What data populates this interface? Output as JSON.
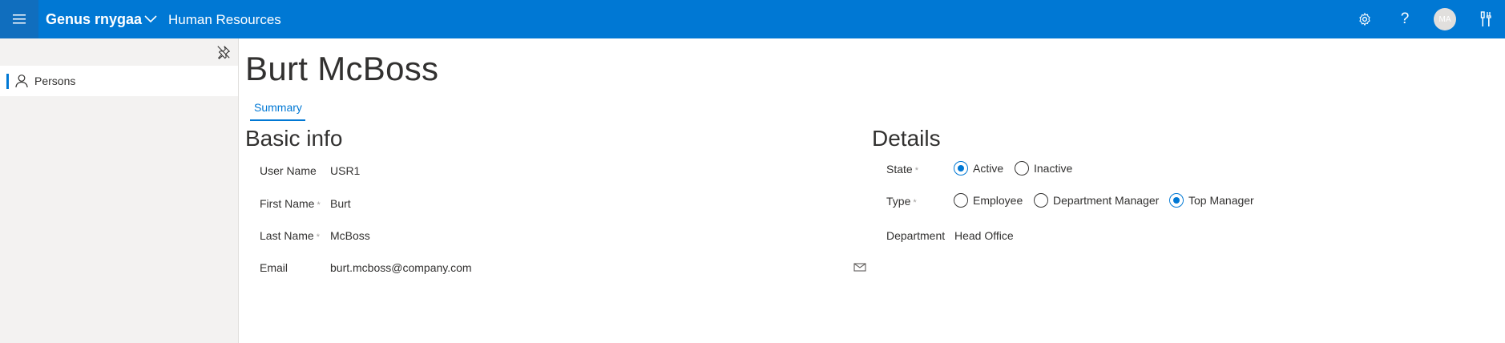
{
  "topbar": {
    "app_name": "Genus rnygaa",
    "module_name": "Human Resources",
    "avatar_initials": "MA",
    "help_glyph": "?",
    "accent_color": "#0078d4"
  },
  "sidebar": {
    "items": [
      {
        "label": "Persons",
        "icon": "person-icon",
        "selected": true
      }
    ]
  },
  "page": {
    "title": "Burt McBoss",
    "tabs": [
      {
        "label": "Summary",
        "active": true
      }
    ]
  },
  "basic_info": {
    "title": "Basic info",
    "required_mark": "*",
    "fields": [
      {
        "label": "User Name",
        "value": "USR1",
        "required": false
      },
      {
        "label": "First Name",
        "value": "Burt",
        "required": true
      },
      {
        "label": "Last Name",
        "value": "McBoss",
        "required": true
      },
      {
        "label": "Email",
        "value": "burt.mcboss@company.com",
        "required": false
      }
    ]
  },
  "details": {
    "title": "Details",
    "state": {
      "label": "State",
      "options": [
        "Active",
        "Inactive"
      ],
      "selected": "Active"
    },
    "type": {
      "label": "Type",
      "options": [
        "Employee",
        "Department Manager",
        "Top Manager"
      ],
      "selected": "Top Manager"
    },
    "department": {
      "label": "Department",
      "value": "Head Office"
    }
  }
}
